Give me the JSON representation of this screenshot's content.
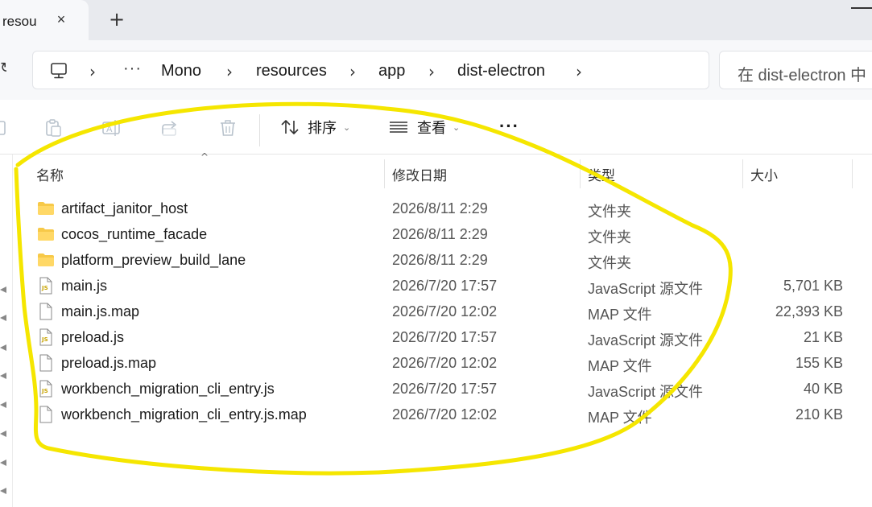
{
  "tab": {
    "title": "resou",
    "close_icon": "×"
  },
  "newtab_icon": "+",
  "address": {
    "ellipsis": "···",
    "crumbs": [
      "Mono",
      "resources",
      "app",
      "dist-electron"
    ],
    "search_placeholder": "在 dist-electron 中"
  },
  "toolbar": {
    "sort_label": "排序",
    "view_label": "查看",
    "more_label": "···"
  },
  "columns": {
    "name": "名称",
    "date": "修改日期",
    "type": "类型",
    "size": "大小"
  },
  "files": [
    {
      "name": "artifact_janitor_host",
      "date": "2026/8/11 2:29",
      "type": "文件夹",
      "size": "",
      "icon": "folder-icon"
    },
    {
      "name": "cocos_runtime_facade",
      "date": "2026/8/11 2:29",
      "type": "文件夹",
      "size": "",
      "icon": "folder-icon"
    },
    {
      "name": "platform_preview_build_lane",
      "date": "2026/8/11 2:29",
      "type": "文件夹",
      "size": "",
      "icon": "folder-icon"
    },
    {
      "name": "main.js",
      "date": "2026/7/20 17:57",
      "type": "JavaScript 源文件",
      "size": "5,701 KB",
      "icon": "js-file-icon"
    },
    {
      "name": "main.js.map",
      "date": "2026/7/20 12:02",
      "type": "MAP 文件",
      "size": "22,393 KB",
      "icon": "file-icon"
    },
    {
      "name": "preload.js",
      "date": "2026/7/20 17:57",
      "type": "JavaScript 源文件",
      "size": "21 KB",
      "icon": "js-file-icon"
    },
    {
      "name": "preload.js.map",
      "date": "2026/7/20 12:02",
      "type": "MAP 文件",
      "size": "155 KB",
      "icon": "file-icon"
    },
    {
      "name": "workbench_migration_cli_entry.js",
      "date": "2026/7/20 17:57",
      "type": "JavaScript 源文件",
      "size": "40 KB",
      "icon": "js-file-icon"
    },
    {
      "name": "workbench_migration_cli_entry.js.map",
      "date": "2026/7/20 12:02",
      "type": "MAP 文件",
      "size": "210 KB",
      "icon": "file-icon"
    }
  ],
  "colors": {
    "annotation": "#f5e600",
    "folder": "#f7c948",
    "accent": "#0067c0"
  }
}
